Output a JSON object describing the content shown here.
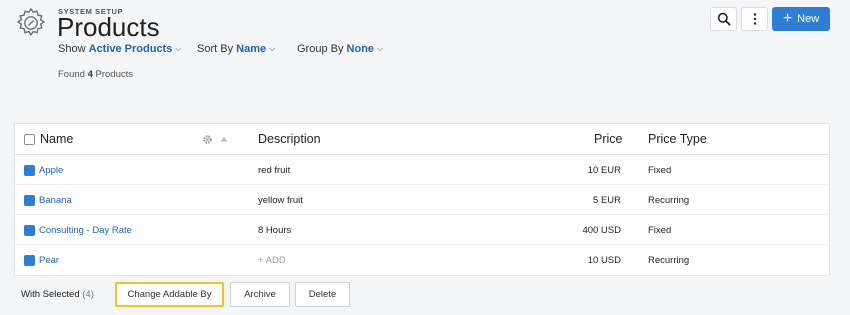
{
  "header": {
    "supertitle": "SYSTEM SETUP",
    "title": "Products",
    "filters": [
      {
        "prefix": "Show",
        "value": "Active Products"
      },
      {
        "prefix": "Sort By",
        "value": "Name"
      },
      {
        "prefix": "Group By",
        "value": "None"
      }
    ],
    "found_prefix": "Found",
    "found_count": "4",
    "found_suffix": "Products",
    "new_button_label": "New",
    "accent_color": "#2e7fd3",
    "link_color": "#1f64a8",
    "icons": [
      "gear-logo-icon",
      "search-icon",
      "more-vertical-icon",
      "plus-icon"
    ]
  },
  "table": {
    "columns": [
      "Name",
      "Description",
      "Price",
      "Price Type"
    ],
    "rows": [
      {
        "name": "Apple",
        "description": "red fruit",
        "price": "10 EUR",
        "price_type": "Fixed",
        "checked": true
      },
      {
        "name": "Banana",
        "description": "yellow fruit",
        "price": "5 EUR",
        "price_type": "Recurring",
        "checked": true
      },
      {
        "name": "Consulting - Day Rate",
        "description": "8 Hours",
        "price": "400 USD",
        "price_type": "Fixed",
        "checked": true
      },
      {
        "name": "Pear",
        "description": "+ ADD",
        "price": "10 USD",
        "price_type": "Recurring",
        "checked": true
      }
    ]
  },
  "footer": {
    "with_selected_label": "With Selected",
    "selected_count": "(4)",
    "buttons": [
      "Change Addable By",
      "Archive",
      "Delete"
    ],
    "highlight_color": "#f0c12a"
  }
}
